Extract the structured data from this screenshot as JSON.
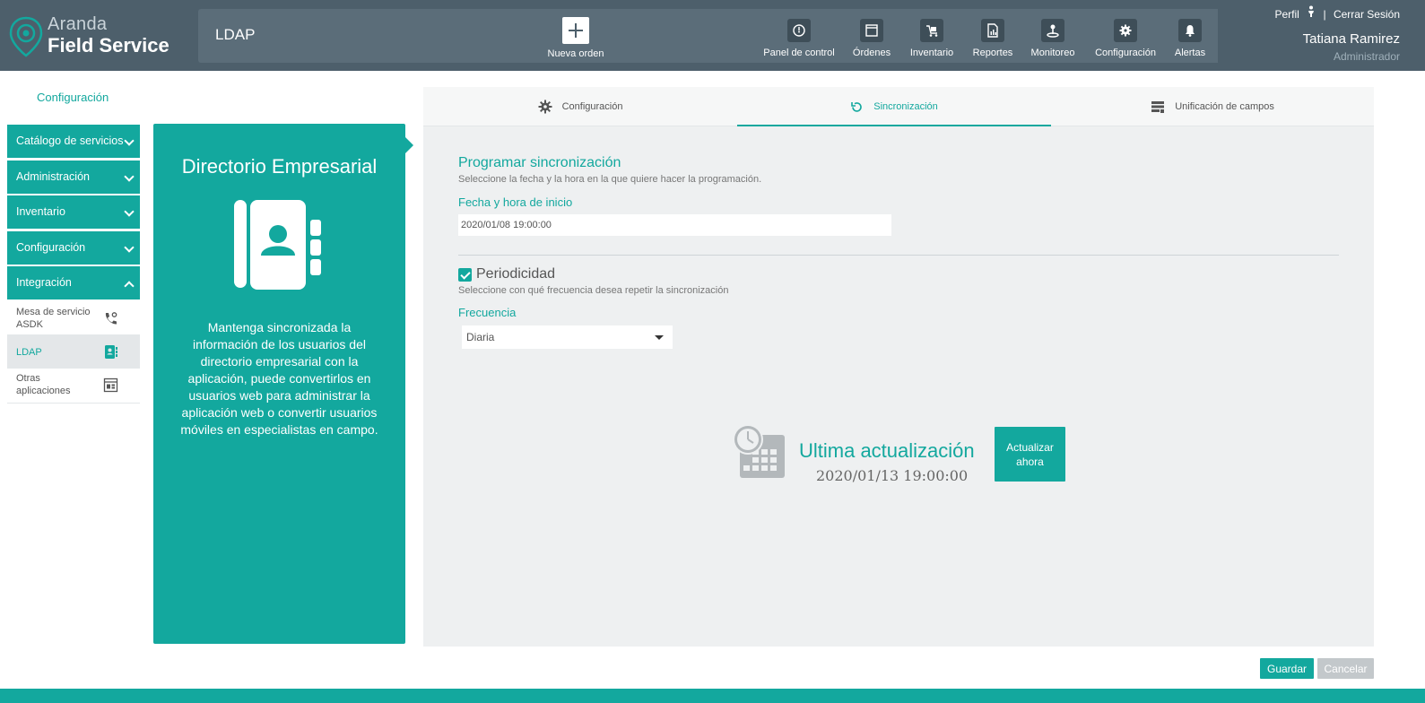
{
  "app": {
    "brand_line1": "Aranda",
    "brand_line2": "Field Service",
    "section_title": "LDAP"
  },
  "header": {
    "new_order_label": "Nueva orden",
    "nav": [
      {
        "label": "Panel de control",
        "icon": "dashboard-icon"
      },
      {
        "label": "Órdenes",
        "icon": "window-icon"
      },
      {
        "label": "Inventario",
        "icon": "cart-icon"
      },
      {
        "label": "Reportes",
        "icon": "report-icon"
      },
      {
        "label": "Monitoreo",
        "icon": "location-icon"
      },
      {
        "label": "Configuración",
        "icon": "gear-icon"
      },
      {
        "label": "Alertas",
        "icon": "bell-icon"
      }
    ],
    "user": {
      "profile_label": "Perfil",
      "separator": "|",
      "logout_label": "Cerrar Sesión",
      "name": "Tatiana Ramirez",
      "role": "Administrador"
    }
  },
  "sidebar": {
    "page_label": "Configuración",
    "groups": [
      {
        "label": "Catálogo de servicios"
      },
      {
        "label": "Administración"
      },
      {
        "label": "Inventario"
      },
      {
        "label": "Configuración"
      },
      {
        "label": "Integración"
      }
    ],
    "sub_items": [
      {
        "label": "Mesa de servicio ASDK",
        "icon": "phone-icon"
      },
      {
        "label": "LDAP",
        "icon": "address-book-icon"
      },
      {
        "label": "Otras aplicaciones",
        "icon": "apps-icon"
      }
    ]
  },
  "directory": {
    "title": "Directorio Empresarial",
    "description": "Mantenga sincronizada la información de los usuarios del directorio empresarial con la aplicación, puede convertirlos en usuarios web para administrar la aplicación web o convertir usuarios móviles en especialistas en campo."
  },
  "tabs": [
    {
      "label": "Configuración",
      "icon": "gear-icon"
    },
    {
      "label": "Sincronización",
      "icon": "refresh-icon"
    },
    {
      "label": "Unificación de campos",
      "icon": "merge-fields-icon"
    }
  ],
  "sync": {
    "program_title": "Programar sincronización",
    "program_help": "Seleccione la fecha y la hora en la que quiere hacer la programación.",
    "start_label": "Fecha y hora de inicio",
    "start_value": "2020/01/08 19:00:00",
    "periodicity_label": "Periodicidad",
    "periodicity_checked": true,
    "periodicity_help": "Seleccione con qué frecuencia desea repetir la sincronización",
    "frequency_label": "Frecuencia",
    "frequency_value": "Diaria",
    "last_update_label": "Ultima actualización",
    "last_update_value": "2020/01/13 19:00:00",
    "update_now_label": "Actualizar ahora"
  },
  "actions": {
    "save_label": "Guardar",
    "cancel_label": "Cancelar"
  },
  "colors": {
    "accent": "#13a89e",
    "header": "#4d5f6b",
    "panel_bg": "#eef0f1"
  }
}
